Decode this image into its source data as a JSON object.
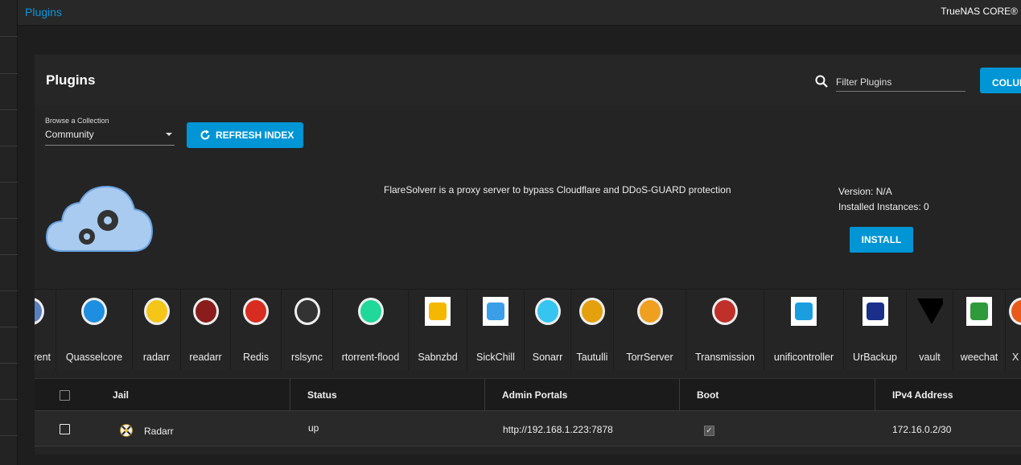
{
  "topbar": {
    "breadcrumb": "Plugins",
    "brand": "TrueNAS CORE®"
  },
  "card": {
    "title": "Plugins",
    "filter_placeholder": "Filter Plugins",
    "columns_label": "COLUMNS"
  },
  "collection": {
    "label": "Browse a Collection",
    "value": "Community"
  },
  "refresh_label": "REFRESH INDEX",
  "selected_plugin": {
    "description": "FlareSolverr is a proxy server to bypass Cloudflare and DDoS-GUARD protection",
    "version": "Version: N/A",
    "instances": "Installed Instances: 0",
    "install_label": "INSTALL"
  },
  "plugins": [
    {
      "name": "rent",
      "icon": "qbittorrent-icon",
      "color": "#5a7fbf"
    },
    {
      "name": "Quasselcore",
      "icon": "quassel-icon",
      "color": "#1e8fe0"
    },
    {
      "name": "radarr",
      "icon": "radarr-icon",
      "color": "#f5c518"
    },
    {
      "name": "readarr",
      "icon": "readarr-icon",
      "color": "#8b1c1c"
    },
    {
      "name": "Redis",
      "icon": "redis-icon",
      "color": "#d82c20"
    },
    {
      "name": "rslsync",
      "icon": "rslsync-icon",
      "color": "#333333"
    },
    {
      "name": "rtorrent-flood",
      "icon": "flood-icon",
      "color": "#1fd89a"
    },
    {
      "name": "Sabnzbd",
      "icon": "sabnzbd-icon",
      "color": "#f5b800"
    },
    {
      "name": "SickChill",
      "icon": "sickchill-icon",
      "color": "#3b9ee8"
    },
    {
      "name": "Sonarr",
      "icon": "sonarr-icon",
      "color": "#35c5f0"
    },
    {
      "name": "Tautulli",
      "icon": "tautulli-icon",
      "color": "#e5a00d"
    },
    {
      "name": "TorrServer",
      "icon": "torrserver-icon",
      "color": "#f0a020"
    },
    {
      "name": "Transmission",
      "icon": "transmission-icon",
      "color": "#c0302a"
    },
    {
      "name": "unificontroller",
      "icon": "unifi-icon",
      "color": "#1a9ee0"
    },
    {
      "name": "UrBackup",
      "icon": "urbackup-icon",
      "color": "#1a2f8a"
    },
    {
      "name": "vault",
      "icon": "vault-icon",
      "color": "#000000"
    },
    {
      "name": "weechat",
      "icon": "weechat-icon",
      "color": "#2f9a3a"
    },
    {
      "name": "X",
      "icon": "plugin-icon",
      "color": "#e85a1a"
    }
  ],
  "table": {
    "headers": [
      "Jail",
      "Status",
      "Admin Portals",
      "Boot",
      "IPv4 Address"
    ],
    "rows": [
      {
        "jail": "Radarr",
        "status": "up",
        "portal": "http://192.168.1.223:7878",
        "boot": true,
        "ipv4": "172.16.0.2/30"
      }
    ]
  },
  "colors": {
    "accent": "#0095d5",
    "link": "#0d95d8"
  }
}
